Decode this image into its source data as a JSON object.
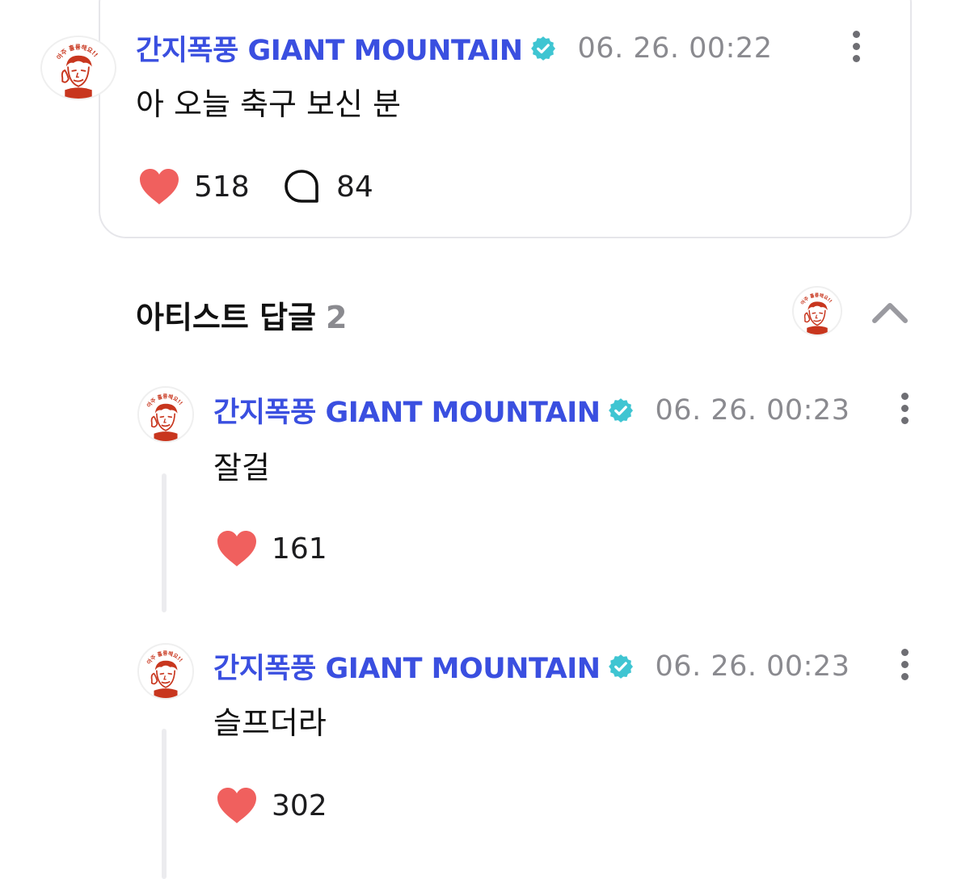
{
  "colors": {
    "author_blue": "#3a4fe0",
    "verified_teal": "#3fc5d2",
    "heart_red": "#f0605e",
    "muted_gray": "#8a8a8f"
  },
  "post": {
    "author": "간지폭풍 GIANT MOUNTAIN",
    "timestamp": "06. 26. 00:22",
    "content": "아 오늘 축구 보신 분",
    "like_count": "518",
    "comment_count": "84",
    "avatar_stamp_text": "아주 훌륭해요!!"
  },
  "artist_replies": {
    "title": "아티스트 답글",
    "count": "2",
    "avatar_stamp_text": "아주 훌륭해요!!",
    "replies": [
      {
        "author": "간지폭풍 GIANT MOUNTAIN",
        "timestamp": "06. 26. 00:23",
        "content": "잘걸",
        "like_count": "161",
        "avatar_stamp_text": "아주 훌륭해요!!"
      },
      {
        "author": "간지폭풍 GIANT MOUNTAIN",
        "timestamp": "06. 26. 00:23",
        "content": "슬프더라",
        "like_count": "302",
        "avatar_stamp_text": "아주 훌륭해요!!"
      }
    ]
  },
  "icons": {
    "verified": "verified-badge-icon",
    "more": "more-vertical-icon",
    "like": "heart-icon",
    "comment": "comment-bubble-icon",
    "collapse": "chevron-up-icon"
  }
}
